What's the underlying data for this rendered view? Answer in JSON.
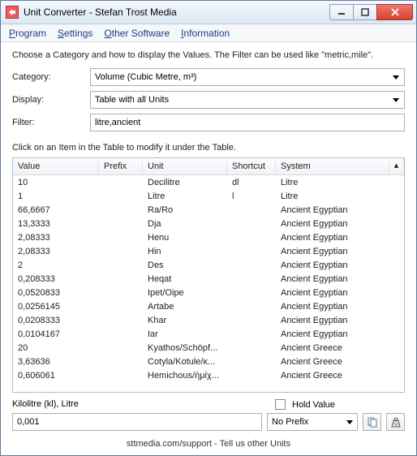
{
  "window": {
    "title": "Unit Converter - Stefan Trost Media"
  },
  "menu": {
    "program": "rogram",
    "settings": "ettings",
    "other": "ther Software",
    "info": "nformation"
  },
  "intro": "Choose a Category and how to display the Values. The Filter can be used like \"metric,mile\".",
  "form": {
    "category_label": "Category:",
    "category_value": "Volume (Cubic Metre, m³)",
    "display_label": "Display:",
    "display_value": "Table with all Units",
    "filter_label": "Filter:",
    "filter_value": "litre,ancient"
  },
  "table": {
    "hint": "Click on an Item in the Table to modify it under the Table.",
    "columns": [
      "Value",
      "Prefix",
      "Unit",
      "Shortcut",
      "System"
    ],
    "rows": [
      {
        "value": "10",
        "prefix": "",
        "unit": "Decilitre",
        "shortcut": "dl",
        "system": "Litre"
      },
      {
        "value": "1",
        "prefix": "",
        "unit": "Litre",
        "shortcut": "l",
        "system": "Litre"
      },
      {
        "value": "66,6667",
        "prefix": "",
        "unit": "Ra/Ro",
        "shortcut": "",
        "system": "Ancient Egyptian"
      },
      {
        "value": "13,3333",
        "prefix": "",
        "unit": "Dja",
        "shortcut": "",
        "system": "Ancient Egyptian"
      },
      {
        "value": "2,08333",
        "prefix": "",
        "unit": "Henu",
        "shortcut": "",
        "system": "Ancient Egyptian"
      },
      {
        "value": "2,08333",
        "prefix": "",
        "unit": "Hin",
        "shortcut": "",
        "system": "Ancient Egyptian"
      },
      {
        "value": "2",
        "prefix": "",
        "unit": "Des",
        "shortcut": "",
        "system": "Ancient Egyptian"
      },
      {
        "value": "0,208333",
        "prefix": "",
        "unit": "Heqat",
        "shortcut": "",
        "system": "Ancient Egyptian"
      },
      {
        "value": "0,0520833",
        "prefix": "",
        "unit": "Ipet/Oipe",
        "shortcut": "",
        "system": "Ancient Egyptian"
      },
      {
        "value": "0,0256145",
        "prefix": "",
        "unit": "Artabe",
        "shortcut": "",
        "system": "Ancient Egyptian"
      },
      {
        "value": "0,0208333",
        "prefix": "",
        "unit": "Khar",
        "shortcut": "",
        "system": "Ancient Egyptian"
      },
      {
        "value": "0,0104167",
        "prefix": "",
        "unit": "Iar",
        "shortcut": "",
        "system": "Ancient Egyptian"
      },
      {
        "value": "20",
        "prefix": "",
        "unit": "Kyathos/Schöpf...",
        "shortcut": "",
        "system": "Ancient Greece"
      },
      {
        "value": "3,63636",
        "prefix": "",
        "unit": "Cotyla/Kotule/κ...",
        "shortcut": "",
        "system": "Ancient Greece"
      },
      {
        "value": "0,606061",
        "prefix": "",
        "unit": "Hemichous/ἡμίχ...",
        "shortcut": "",
        "system": "Ancient Greece"
      }
    ]
  },
  "below": {
    "selected": "Kilolitre (kl), Litre",
    "hold_label": "Hold Value",
    "value": "0,001",
    "prefix": "No Prefix"
  },
  "footer": "sttmedia.com/support - Tell us other Units"
}
